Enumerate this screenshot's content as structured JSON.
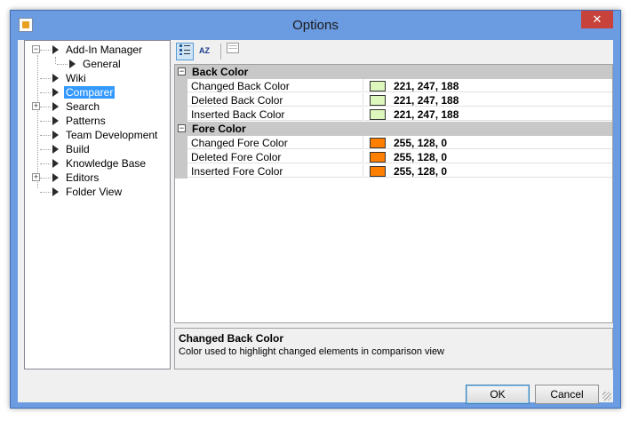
{
  "window": {
    "title": "Options",
    "close_glyph": "✕"
  },
  "tree": {
    "items": [
      {
        "label": "Add-In Manager",
        "expander": "−"
      },
      {
        "label": "General"
      },
      {
        "label": "Wiki"
      },
      {
        "label": "Comparer",
        "selected": true
      },
      {
        "label": "Search",
        "expander": "+"
      },
      {
        "label": "Patterns"
      },
      {
        "label": "Team Development"
      },
      {
        "label": "Build"
      },
      {
        "label": "Knowledge Base"
      },
      {
        "label": "Editors",
        "expander": "+"
      },
      {
        "label": "Folder View"
      }
    ]
  },
  "toolbar": {
    "categorized_icon": "categorized-icon",
    "alphabetical_label": "AZ",
    "property_pages_icon": "property-pages-icon"
  },
  "grid": {
    "categories": [
      {
        "label": "Back Color",
        "toggle": "−",
        "properties": [
          {
            "name": "Changed Back Color",
            "value": "221, 247, 188",
            "color": "#ddf7bc"
          },
          {
            "name": "Deleted Back Color",
            "value": "221, 247, 188",
            "color": "#ddf7bc"
          },
          {
            "name": "Inserted Back Color",
            "value": "221, 247, 188",
            "color": "#ddf7bc"
          }
        ]
      },
      {
        "label": "Fore Color",
        "toggle": "−",
        "properties": [
          {
            "name": "Changed Fore Color",
            "value": "255, 128, 0",
            "color": "#ff8000"
          },
          {
            "name": "Deleted Fore Color",
            "value": "255, 128, 0",
            "color": "#ff8000"
          },
          {
            "name": "Inserted Fore Color",
            "value": "255, 128, 0",
            "color": "#ff8000"
          }
        ]
      }
    ]
  },
  "description": {
    "title": "Changed Back Color",
    "text": "Color used to highlight changed elements in comparison view"
  },
  "buttons": {
    "ok": "OK",
    "cancel": "Cancel"
  }
}
